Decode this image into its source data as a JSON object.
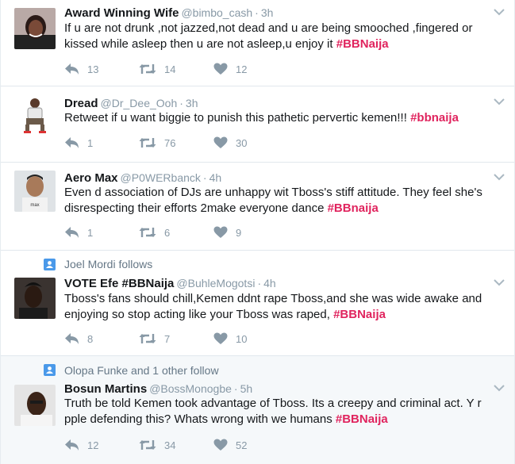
{
  "tweets": [
    {
      "fullname": "Award Winning Wife",
      "username": "@bimbo_cash",
      "time": "3h",
      "text": "If u are not drunk ,not jazzed,not dead and u are being smooched ,fingered or kissed while asleep then u are not asleep,u enjoy it",
      "hashtag": "#BBNaija",
      "replies": "13",
      "retweets": "14",
      "likes": "12"
    },
    {
      "fullname": "Dread",
      "username": "@Dr_Dee_Ooh",
      "time": "3h",
      "text": "Retweet if u want biggie to punish this pathetic pervertic kemen!!!",
      "hashtag": "#bbnaija",
      "replies": "1",
      "retweets": "76",
      "likes": "30"
    },
    {
      "fullname": "Aero Max",
      "username": "@P0WERbanck",
      "time": "4h",
      "text": "Even d association of DJs are unhappy wit Tboss's stiff attitude. They feel she's disrespecting their efforts 2make everyone dance",
      "hashtag": "#BBnaija",
      "replies": "1",
      "retweets": "6",
      "likes": "9"
    },
    {
      "context": "Joel Mordi follows",
      "fullname": "VOTE Efe #BBNaija",
      "username": "@BuhleMogotsi",
      "time": "4h",
      "text": "Tboss's fans should chill,Kemen ddnt rape Tboss,and she was wide awake and enjoying so stop acting like your Tboss was raped,",
      "hashtag": "#BBNaija",
      "replies": "8",
      "retweets": "7",
      "likes": "10"
    },
    {
      "context": "Olopa Funke and 1 other follow",
      "fullname": "Bosun Martins",
      "username": "@BossMonogbe",
      "time": "5h",
      "text": "Truth be told Kemen took advantage of Tboss. Its a creepy and criminal act. Y r pple defending this? Whats wrong with we humans",
      "hashtag": "#BBNaija",
      "replies": "12",
      "retweets": "34",
      "likes": "52"
    }
  ],
  "icons": {
    "reply": "reply-icon",
    "retweet": "retweet-icon",
    "like": "heart-icon",
    "caret": "chevron-down-icon",
    "follow_context": "person-icon"
  },
  "colors": {
    "hashtag": "#e0245e",
    "icon_gray": "#8899a6",
    "context_blue": "#4a99e9",
    "shaded_row": "#f5f8fa"
  }
}
